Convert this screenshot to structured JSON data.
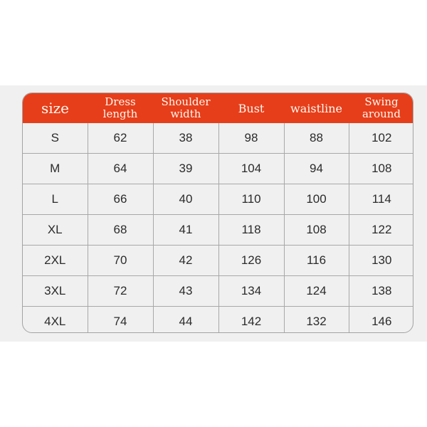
{
  "size_chart": {
    "headers": [
      {
        "line1": "size",
        "line2": ""
      },
      {
        "line1": "Dress",
        "line2": "length"
      },
      {
        "line1": "Shoulder",
        "line2": "width"
      },
      {
        "line1": "Bust",
        "line2": ""
      },
      {
        "line1": "waistline",
        "line2": ""
      },
      {
        "line1": "Swing",
        "line2": "around"
      }
    ],
    "rows": [
      [
        "S",
        "62",
        "38",
        "98",
        "88",
        "102"
      ],
      [
        "M",
        "64",
        "39",
        "104",
        "94",
        "108"
      ],
      [
        "L",
        "66",
        "40",
        "110",
        "100",
        "114"
      ],
      [
        "XL",
        "68",
        "41",
        "118",
        "108",
        "122"
      ],
      [
        "2XL",
        "70",
        "42",
        "126",
        "116",
        "130"
      ],
      [
        "3XL",
        "72",
        "43",
        "134",
        "124",
        "138"
      ],
      [
        "4XL",
        "74",
        "44",
        "142",
        "132",
        "146"
      ]
    ],
    "colors": {
      "header_bg": "#e63e1a",
      "header_text": "#fff7ef",
      "body_bg": "#f0f0f0",
      "grid": "#a8a8a8",
      "cell_text": "#2b2b2b"
    }
  }
}
